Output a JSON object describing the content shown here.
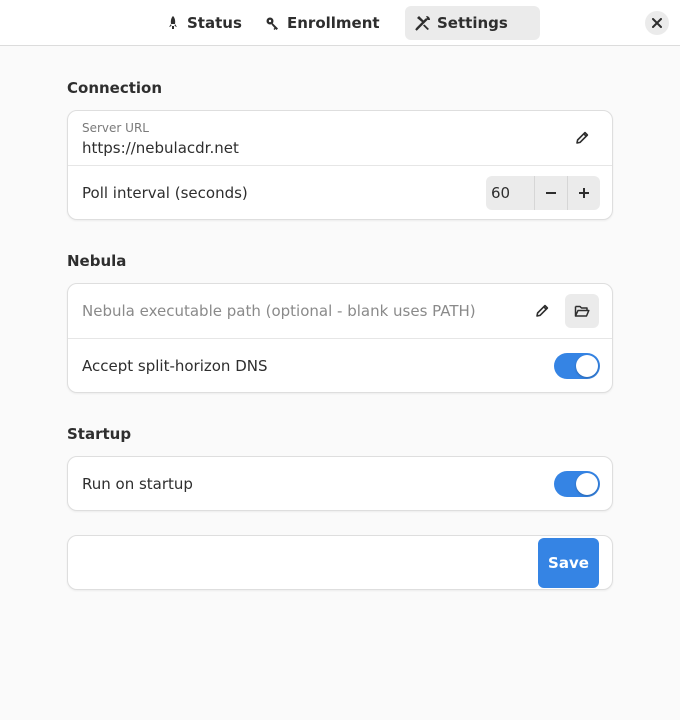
{
  "header": {
    "tabs": [
      {
        "label": "Status",
        "icon": "rocket-icon",
        "active": false
      },
      {
        "label": "Enrollment",
        "icon": "key-icon",
        "active": false
      },
      {
        "label": "Settings",
        "icon": "tools-icon",
        "active": true
      }
    ],
    "close_icon": "close-icon"
  },
  "connection": {
    "title": "Connection",
    "server_url": {
      "label": "Server URL",
      "value": "https://nebulacdr.net"
    },
    "poll_interval": {
      "label": "Poll interval (seconds)",
      "value": "60"
    }
  },
  "nebula": {
    "title": "Nebula",
    "exec_path": {
      "placeholder": "Nebula executable path (optional - blank uses PATH)"
    },
    "split_dns": {
      "label": "Accept split-horizon DNS",
      "enabled": true
    }
  },
  "startup": {
    "title": "Startup",
    "run_on_startup": {
      "label": "Run on startup",
      "enabled": true
    }
  },
  "actions": {
    "save_label": "Save"
  },
  "colors": {
    "accent": "#3584e4",
    "window_bg": "#fafafa",
    "card_bg": "#ffffff"
  }
}
